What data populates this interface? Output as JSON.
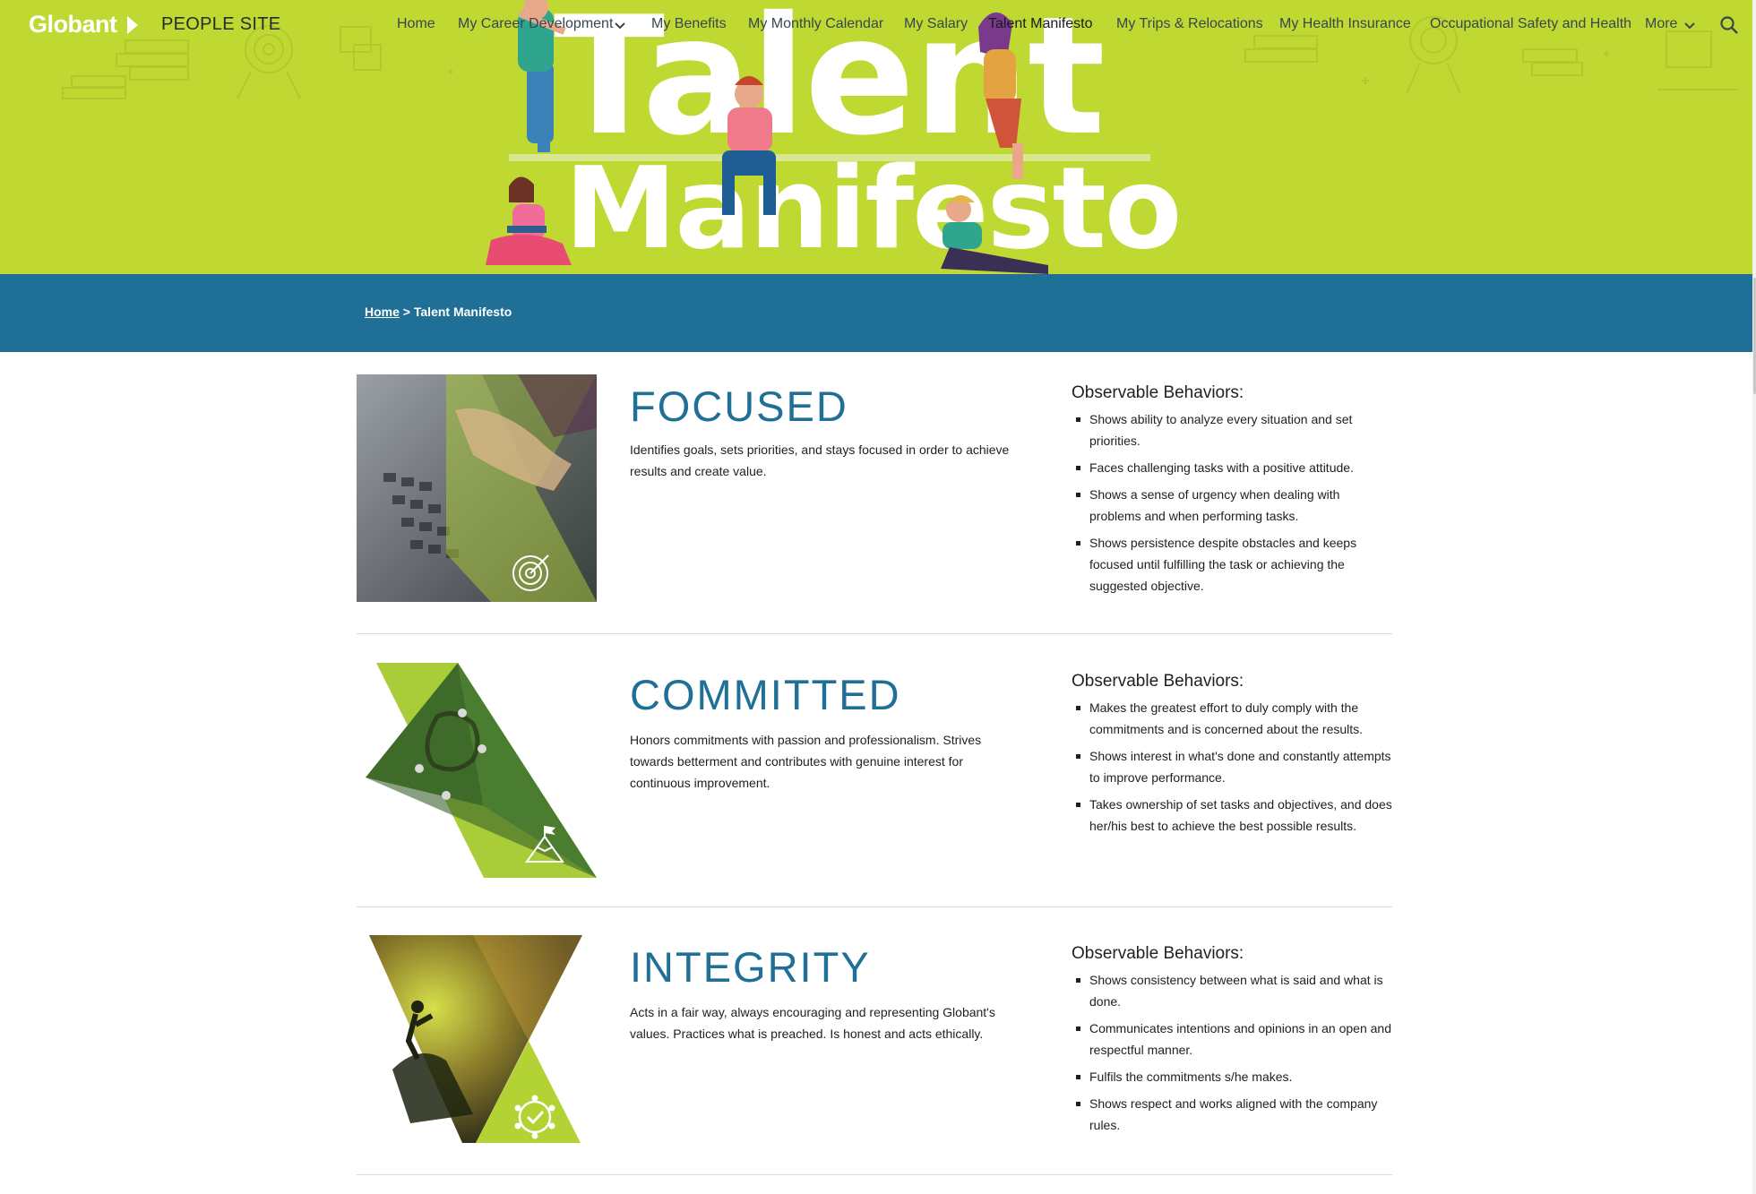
{
  "nav": {
    "logo": "Globant",
    "site_name": "PEOPLE SITE",
    "items": [
      {
        "label": "Home"
      },
      {
        "label": "My Career Development"
      },
      {
        "label": "My Benefits"
      },
      {
        "label": "My Monthly Calendar"
      },
      {
        "label": "My Salary"
      },
      {
        "label": "Talent Manifesto"
      },
      {
        "label": "My Trips & Relocations"
      },
      {
        "label": "My Health Insurance"
      },
      {
        "label": "Occupational Safety and Health"
      },
      {
        "label": "More"
      }
    ],
    "active_item": "Talent Manifesto",
    "search_icon": "search-icon"
  },
  "hero": {
    "line1": "Talent",
    "line2": "Manifesto"
  },
  "breadcrumb": {
    "home": "Home",
    "separator": " > ",
    "current": "Talent Manifesto"
  },
  "sections": [
    {
      "title": "FOCUSED",
      "description": "Identifies goals, sets priorities, and stays focused in order to achieve results and create value.",
      "behaviors_title": "Observable Behaviors:",
      "behaviors": [
        "Shows ability to analyze every situation and set priorities.",
        "Faces challenging tasks with a positive attitude.",
        "Shows a sense of urgency when dealing with problems and when performing tasks.",
        "Shows persistence despite obstacles and keeps focused until fulfilling the task or achieving the suggested objective."
      ],
      "icon": "target-icon"
    },
    {
      "title": "COMMITTED",
      "description": "Honors commitments with passion and professionalism. Strives towards betterment and contributes with genuine interest for continuous improvement.",
      "behaviors_title": "Observable Behaviors:",
      "behaviors": [
        "Makes the greatest effort to duly comply with the commitments and is concerned about the results.",
        "Shows interest in what's done and constantly attempts to improve performance.",
        "Takes ownership of set tasks and objectives, and does her/his best to achieve the best possible results."
      ],
      "icon": "mountain-flag-icon"
    },
    {
      "title": "INTEGRITY",
      "description": "Acts in a fair way, always encouraging and representing Globant's values. Practices what is preached. Is honest and acts ethically.",
      "behaviors_title": "Observable Behaviors:",
      "behaviors": [
        "Shows consistency between what is said and what is done.",
        "Communicates intentions and opinions in an open and respectful manner.",
        "Fulfils the commitments s/he makes.",
        "Shows respect and works aligned with the company rules."
      ],
      "icon": "check-network-icon"
    }
  ],
  "colors": {
    "hero_green": "#c0d932",
    "band_blue": "#1f6f96",
    "title_blue": "#1f6f96"
  }
}
